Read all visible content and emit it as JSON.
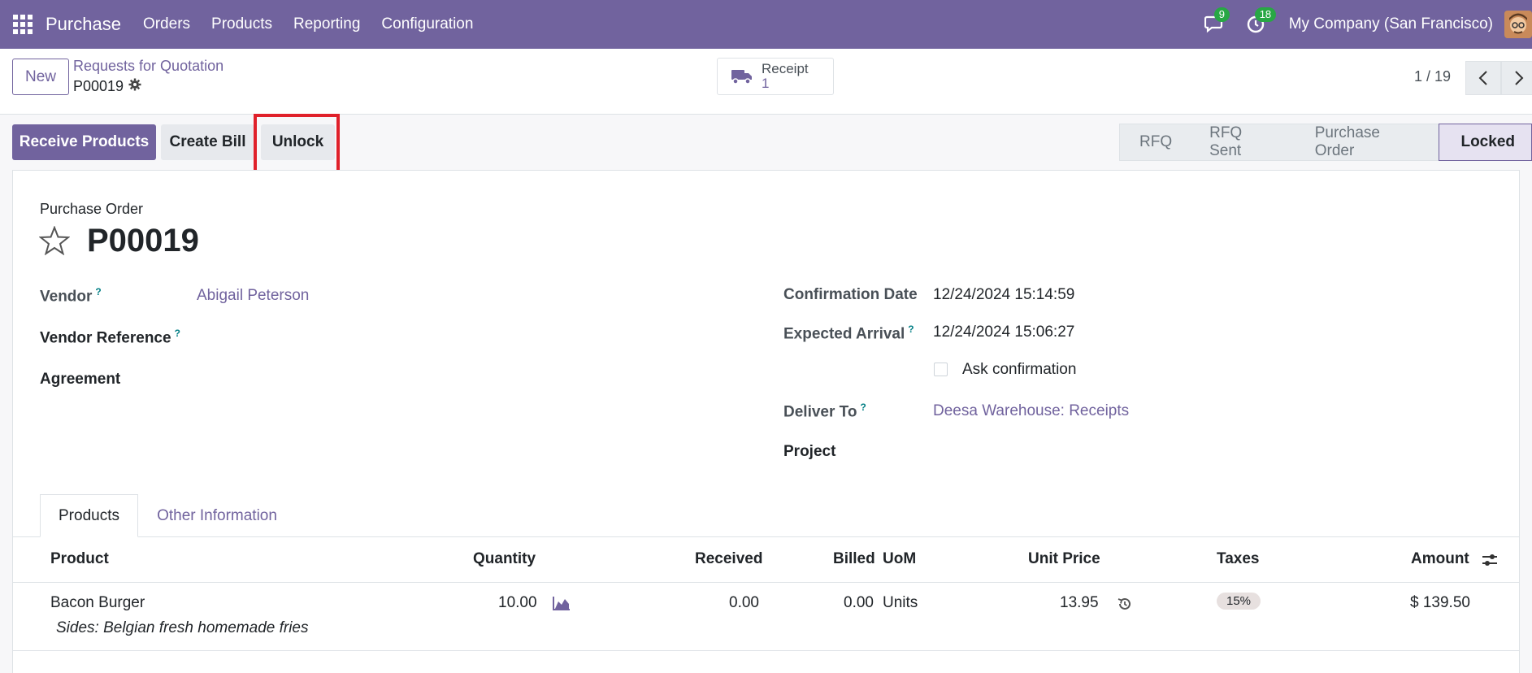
{
  "navbar": {
    "app_name": "Purchase",
    "menu": [
      "Orders",
      "Products",
      "Reporting",
      "Configuration"
    ],
    "messages_count": "9",
    "activities_count": "18",
    "company": "My Company (San Francisco)"
  },
  "control": {
    "new_label": "New",
    "breadcrumb": "Requests for Quotation",
    "record_name": "P00019",
    "smart_button": {
      "label": "Receipt",
      "value": "1",
      "icon": "truck-icon"
    },
    "pager": "1 / 19"
  },
  "actions": {
    "receive": "Receive Products",
    "create_bill": "Create Bill",
    "unlock": "Unlock"
  },
  "status": {
    "stages": [
      "RFQ",
      "RFQ Sent",
      "Purchase Order",
      "Locked"
    ],
    "active": "Locked"
  },
  "form": {
    "type_label": "Purchase Order",
    "reference": "P00019",
    "vendor_label": "Vendor",
    "vendor_value": "Abigail Peterson",
    "vendor_ref_label": "Vendor Reference",
    "agreement_label": "Agreement",
    "confirmation_label": "Confirmation Date",
    "confirmation_value": "12/24/2024 15:14:59",
    "expected_label": "Expected Arrival",
    "expected_value": "12/24/2024 15:06:27",
    "ask_confirmation": "Ask confirmation",
    "deliver_label": "Deliver To",
    "deliver_value": "Deesa Warehouse: Receipts",
    "project_label": "Project",
    "help_mark": "?"
  },
  "tabs": [
    "Products",
    "Other Information"
  ],
  "table": {
    "headers": {
      "product": "Product",
      "quantity": "Quantity",
      "received": "Received",
      "billed": "Billed",
      "uom": "UoM",
      "unit_price": "Unit Price",
      "taxes": "Taxes",
      "amount": "Amount"
    },
    "rows": [
      {
        "product": "Bacon Burger",
        "description": "Sides: Belgian fresh homemade fries",
        "quantity": "10.00",
        "received": "0.00",
        "billed": "0.00",
        "uom": "Units",
        "unit_price": "13.95",
        "taxes": "15%",
        "amount": "$ 139.50"
      }
    ]
  },
  "colors": {
    "brand": "#71639e",
    "highlight": "#e0202a",
    "badge": "#28a745"
  }
}
